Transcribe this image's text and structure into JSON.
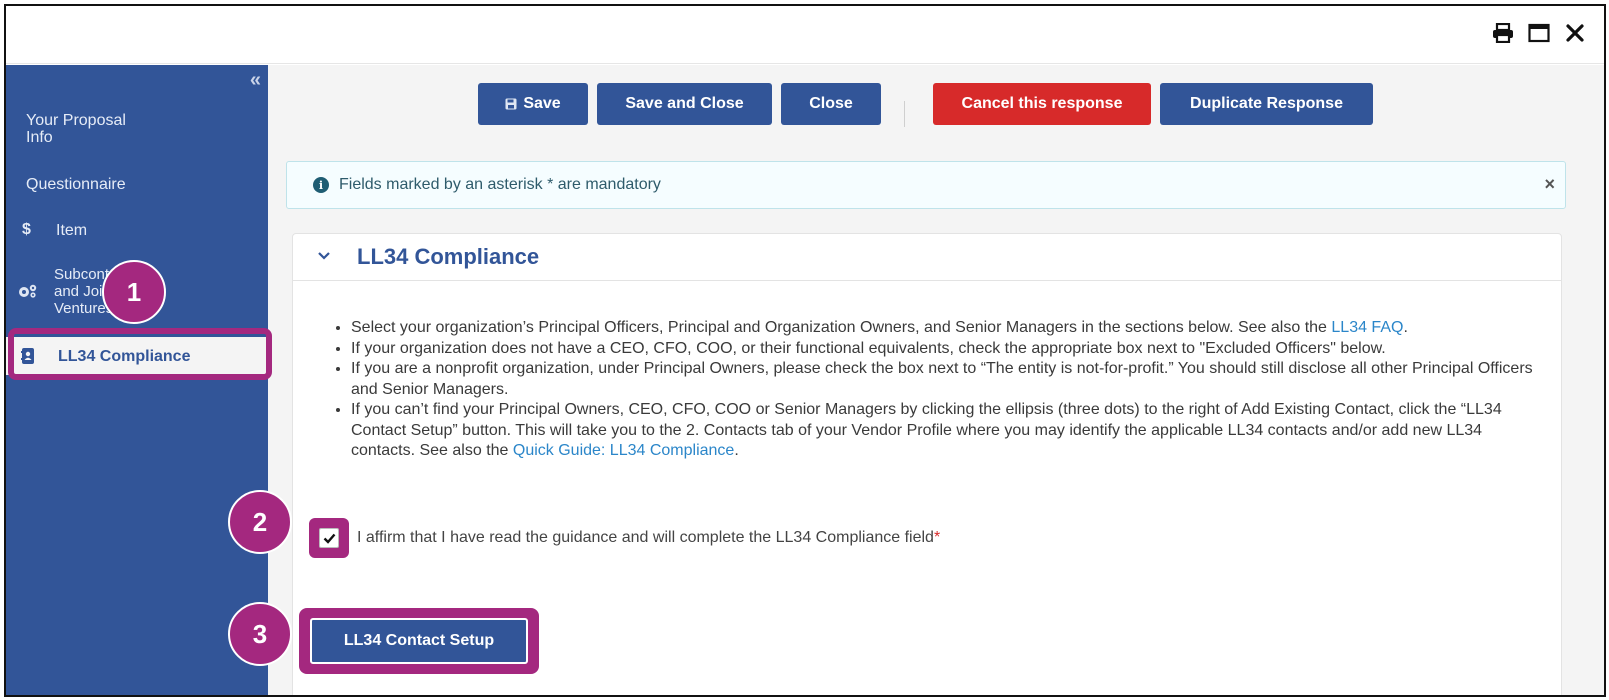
{
  "window": {
    "icons": [
      "print-icon",
      "maximize-icon",
      "close-icon"
    ]
  },
  "sidebar": {
    "collapse_glyph": "«",
    "items": [
      {
        "label": "Your Proposal Info",
        "line1": "Your Proposal",
        "line2": "Info",
        "icon": ""
      },
      {
        "label": "Questionnaire",
        "icon": ""
      },
      {
        "label": "Item",
        "icon": "$"
      },
      {
        "label": "Subcontractors and Joint Ventures",
        "line1": "Subcontractors",
        "line2": "and Joint",
        "line3": "Ventures",
        "icon": "gears-icon"
      },
      {
        "label": "LL34 Compliance",
        "icon": "address-book-icon",
        "active": true
      }
    ]
  },
  "toolbar": {
    "save": "Save",
    "save_and_close": "Save and Close",
    "close": "Close",
    "cancel_response": "Cancel this response",
    "duplicate_response": "Duplicate Response"
  },
  "alert": {
    "message": "Fields marked by an asterisk * are mandatory",
    "close_glyph": "×"
  },
  "panel": {
    "title": "LL34 Compliance",
    "guidance": [
      {
        "text": "Select your organization’s Principal Officers, Principal and Organization Owners, and Senior Managers in the sections below. See also the ",
        "link": "LL34 FAQ",
        "after": "."
      },
      {
        "text": "If your organization does not have a CEO, CFO, COO, or their functional equivalents, check the appropriate box next to \"Excluded Officers\" below.",
        "link": "",
        "after": ""
      },
      {
        "text": "If you are a nonprofit organization, under Principal Owners, please check the box next to “The entity is not-for-profit.” You should still disclose all other Principal Officers and Senior Managers.",
        "link": "",
        "after": ""
      },
      {
        "text": "If you can’t find your Principal Owners, CEO, CFO, COO or Senior Managers by clicking the ellipsis (three dots) to the right of Add Existing Contact, click the “LL34 Contact Setup” button. This will take you to the 2. Contacts tab of your Vendor Profile where you may identify the applicable LL34 contacts and/or add new LL34 contacts. See also the ",
        "link": "Quick Guide: LL34 Compliance",
        "after": "."
      }
    ],
    "affirm_label": "I affirm that I have read the guidance and will complete the LL34 Compliance field",
    "affirm_checked": true,
    "required_mark": "*",
    "contact_setup_button": "LL34 Contact Setup"
  },
  "annotations": {
    "badge1": "1",
    "badge2": "2",
    "badge3": "3",
    "highlight_color": "#a4287f"
  },
  "colors": {
    "primary": "#325598",
    "danger": "#d72a2a",
    "link": "#2b86c9"
  }
}
